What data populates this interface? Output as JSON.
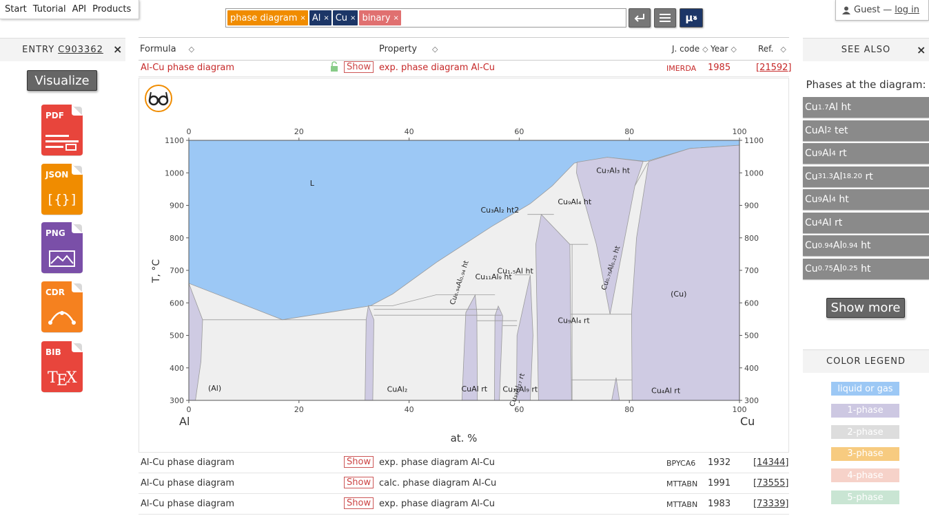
{
  "nav": {
    "items": [
      "Start",
      "Tutorial",
      "API",
      "Products"
    ]
  },
  "search": {
    "tags": [
      {
        "label": "phase diagram",
        "color": "#f08c00"
      },
      {
        "label": "Al",
        "color": "#1c3667"
      },
      {
        "label": "Cu",
        "color": "#1c3667"
      },
      {
        "label": "binary",
        "color": "#e07070"
      }
    ],
    "remove_glyph": "×",
    "mux_label": "μ"
  },
  "user": {
    "guest_label": "Guest",
    "separator": "—",
    "login_label": "log in"
  },
  "entry": {
    "prefix": "ENTRY",
    "code": "C903362",
    "close": "×",
    "visualize_label": "Visualize"
  },
  "downloads": [
    {
      "label": "PDF",
      "color": "#e8453c"
    },
    {
      "label": "JSON",
      "color": "#f08c00"
    },
    {
      "label": "PNG",
      "color": "#7a4fa8"
    },
    {
      "label": "CDR",
      "color": "#f5811f"
    },
    {
      "label": "BIB",
      "color": "#e8453c"
    }
  ],
  "table": {
    "headers": {
      "formula": "Formula",
      "property": "Property",
      "jcode": "J. code",
      "year": "Year",
      "ref": "Ref."
    },
    "sort_glyph": "◇",
    "rows": [
      {
        "formula": "Al-Cu phase diagram",
        "show": "Show",
        "property": "exp. phase diagram Al-Cu",
        "jcode": "IMERDA",
        "year": "1985",
        "ref": "[21592]"
      },
      {
        "formula": "Al-Cu phase diagram",
        "show": "Show",
        "property": "exp. phase diagram Al-Cu",
        "jcode": "BPYCA6",
        "year": "1932",
        "ref": "[14344]"
      },
      {
        "formula": "Al-Cu phase diagram",
        "show": "Show",
        "property": "calc. phase diagram Al-Cu",
        "jcode": "MTTABN",
        "year": "1991",
        "ref": "[73555]"
      },
      {
        "formula": "Al-Cu phase diagram",
        "show": "Show",
        "property": "exp. phase diagram Al-Cu",
        "jcode": "MTTABN",
        "year": "1983",
        "ref": "[73339]"
      }
    ]
  },
  "chart_data": {
    "type": "phase-diagram",
    "left_element": "Al",
    "right_element": "Cu",
    "xlabel": "at. %",
    "ylabel": "T, °C",
    "xlim": [
      0,
      100
    ],
    "ylim": [
      300,
      1100
    ],
    "xticks": [
      0,
      20,
      40,
      60,
      80,
      100
    ],
    "yticks": [
      300,
      400,
      500,
      600,
      700,
      800,
      900,
      1000,
      1100
    ],
    "liquidus": [
      [
        0,
        660
      ],
      [
        17,
        548
      ],
      [
        33,
        591
      ],
      [
        37,
        627
      ],
      [
        45,
        725
      ],
      [
        55,
        835
      ],
      [
        62,
        905
      ],
      [
        66,
        960
      ],
      [
        70,
        1030
      ],
      [
        76,
        1048
      ],
      [
        83,
        1035
      ],
      [
        91,
        1075
      ],
      [
        100,
        1085
      ]
    ],
    "labels": [
      {
        "text": "L",
        "x": 22,
        "y": 960
      },
      {
        "text": "(Al)",
        "x": 3.5,
        "y": 330
      },
      {
        "text": "CuAl₂",
        "x": 36,
        "y": 326
      },
      {
        "text": "CuAl rt",
        "x": 49.5,
        "y": 328
      },
      {
        "text": "Cu₁₁Al₉ rt",
        "x": 57,
        "y": 326
      },
      {
        "text": "Cu₃Al₂ ht2",
        "x": 53,
        "y": 878
      },
      {
        "text": "Cu₇Al₃ ht",
        "x": 74,
        "y": 1000
      },
      {
        "text": "Cu₉Al₄ ht",
        "x": 67,
        "y": 903
      },
      {
        "text": "Cu₁.₅Al ht",
        "x": 56,
        "y": 690
      },
      {
        "text": "Cu₁₁Al₉ ht",
        "x": 52,
        "y": 672
      },
      {
        "text": "Cu₉Al₄ rt",
        "x": 67,
        "y": 538
      },
      {
        "text": "(Cu)",
        "x": 87.5,
        "y": 620
      },
      {
        "text": "Cu₄Al rt",
        "x": 84,
        "y": 322
      }
    ],
    "rotated_labels": [
      {
        "text": "Cu₀.₉₄Al₀.₉₄ ht",
        "x": 49.5,
        "y": 660
      },
      {
        "text": "Cu₀.₇₅Al₀.₂₅ ht",
        "x": 77,
        "y": 705
      },
      {
        "text": "Cu₃₃Al₁₇ rt",
        "x": 60,
        "y": 330
      }
    ]
  },
  "see_also": {
    "title": "SEE ALSO",
    "close": "×",
    "phases_title": "Phases at the diagram:",
    "phases": [
      [
        "Cu",
        "1.7",
        "Al",
        "",
        " ht"
      ],
      [
        "CuAl",
        "2",
        "",
        "",
        " tet"
      ],
      [
        "Cu",
        "9",
        "Al",
        "4",
        " rt"
      ],
      [
        "Cu",
        "31.3",
        "Al",
        "18.20",
        " rt"
      ],
      [
        "Cu",
        "9",
        "Al",
        "4",
        " ht"
      ],
      [
        "Cu",
        "4",
        "Al",
        "",
        " rt"
      ],
      [
        "Cu",
        "0.94",
        "Al",
        "0.94",
        " ht"
      ],
      [
        "Cu",
        "0.75",
        "Al",
        "0.25",
        " ht"
      ]
    ],
    "show_more": "Show more"
  },
  "color_legend": {
    "title": "COLOR LEGEND",
    "items": [
      {
        "label": "liquid or gas",
        "color": "#9cc8f5"
      },
      {
        "label": "1-phase",
        "color": "#cdc8e2"
      },
      {
        "label": "2-phase",
        "color": "#dddddd"
      },
      {
        "label": "3-phase",
        "color": "#f7cb80"
      },
      {
        "label": "4-phase",
        "color": "#f6d2c9"
      },
      {
        "label": "5-phase",
        "color": "#c9e5d3"
      }
    ]
  },
  "colors": {
    "liquid": "#9cc8f5",
    "one_phase": "#cfcbe3",
    "two_phase": "#efefef",
    "phase_button": "#8a8a8a"
  }
}
